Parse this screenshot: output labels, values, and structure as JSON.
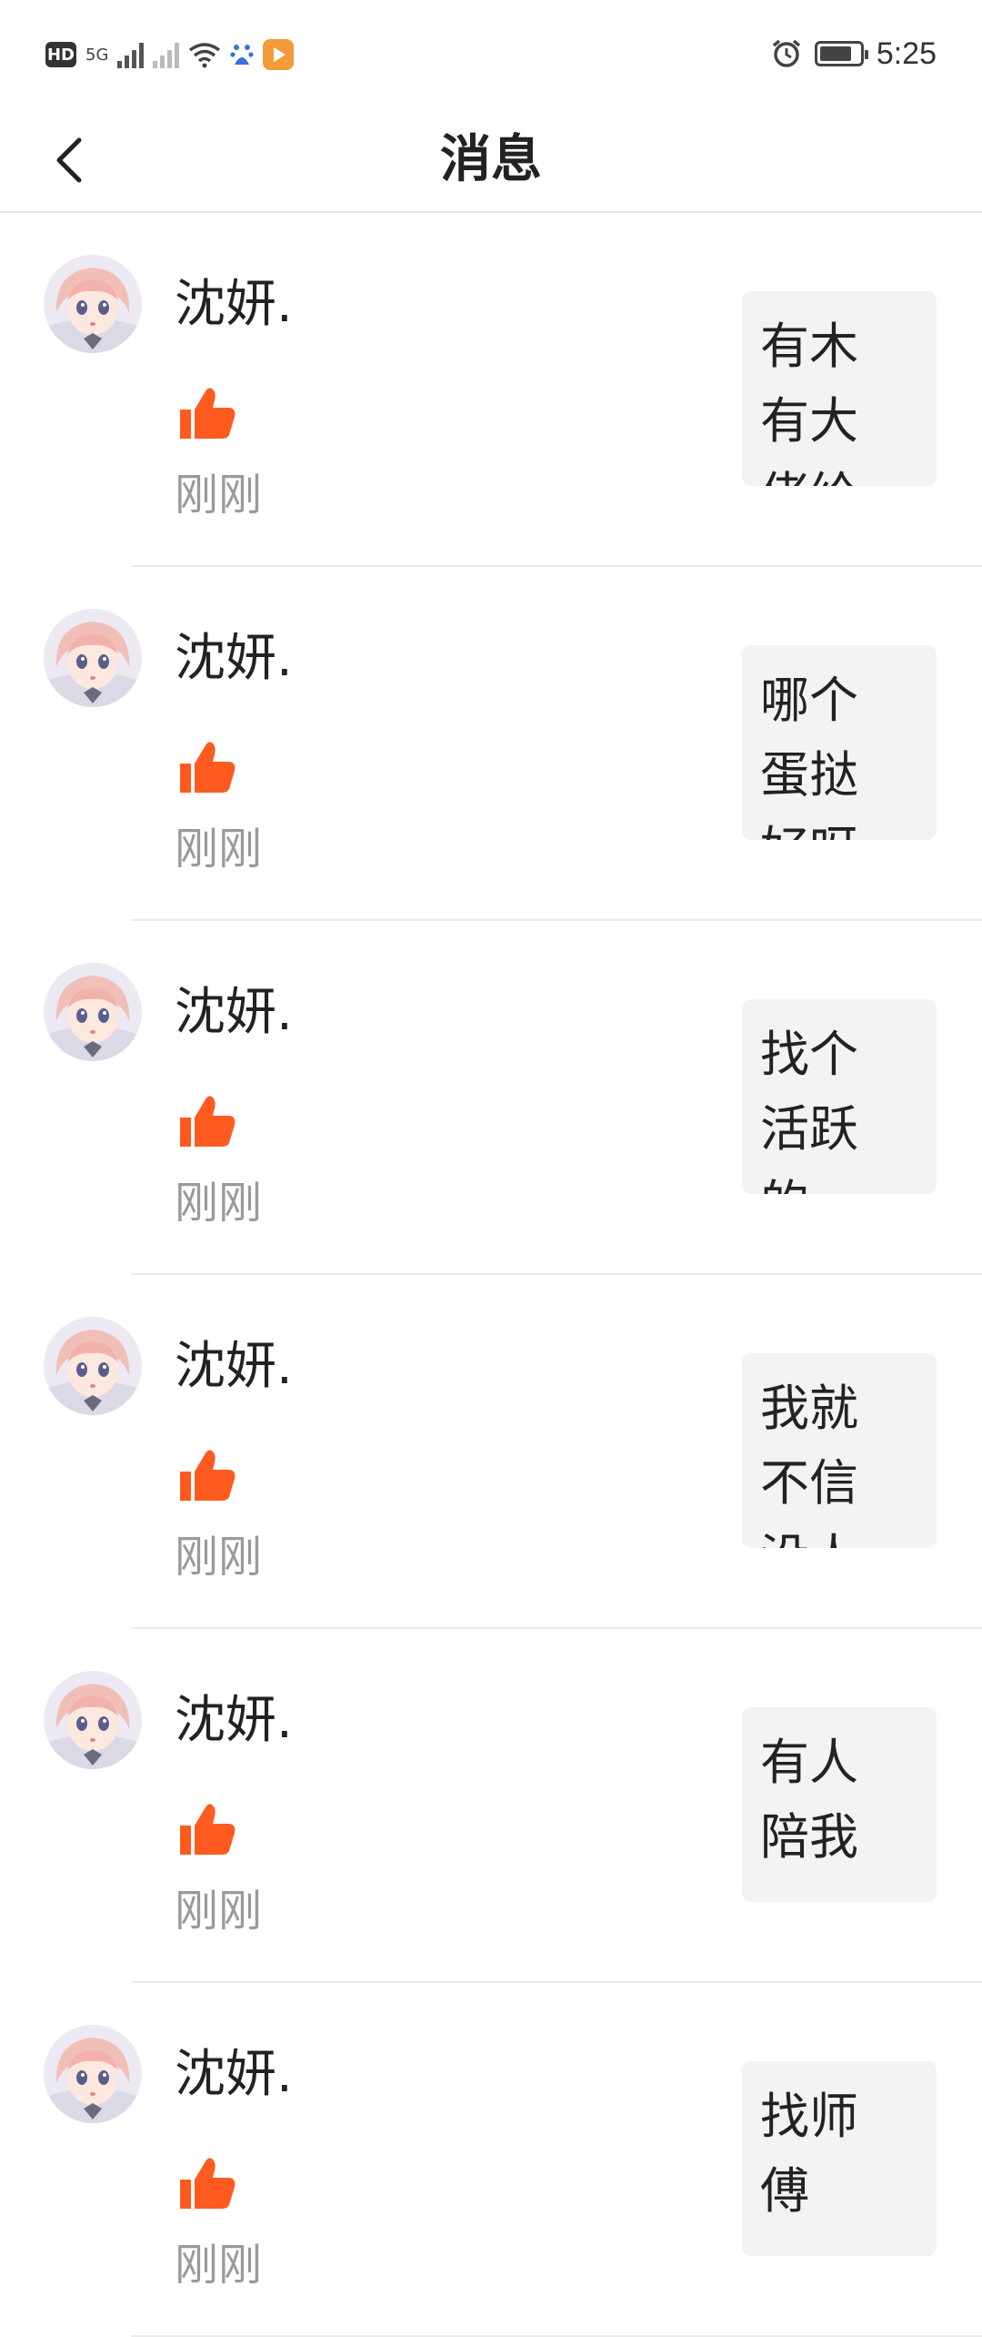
{
  "status_bar": {
    "hd": "HD",
    "network": "5G",
    "time": "5:25",
    "battery_level": 0.8
  },
  "header": {
    "title": "消息"
  },
  "messages": [
    {
      "name": "沈妍.",
      "time": "刚刚",
      "preview": "有木有大佬给"
    },
    {
      "name": "沈妍.",
      "time": "刚刚",
      "preview": "哪个蛋挞好呀"
    },
    {
      "name": "沈妍.",
      "time": "刚刚",
      "preview": "找个活跃的一"
    },
    {
      "name": "沈妍.",
      "time": "刚刚",
      "preview": "我就不信没人"
    },
    {
      "name": "沈妍.",
      "time": "刚刚",
      "preview": "有人陪我一"
    },
    {
      "name": "沈妍.",
      "time": "刚刚",
      "preview": "找师傅"
    }
  ],
  "colors": {
    "like": "#ff5a1f",
    "timestamp": "#9a9a9a",
    "preview_bg": "#f3f3f3"
  }
}
